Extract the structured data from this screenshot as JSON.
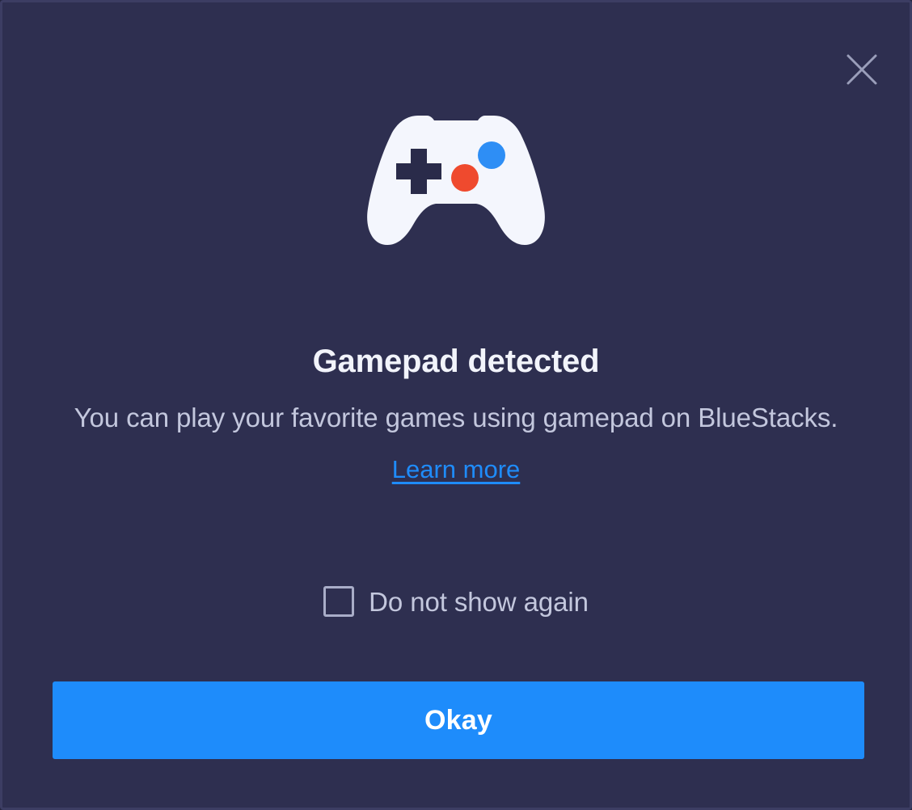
{
  "dialog": {
    "background_color": "#2e2f50",
    "border_color": "#3c3d63"
  },
  "close": {
    "icon_name": "close-icon",
    "label": "Close",
    "color": "#9a9eba"
  },
  "illustration": {
    "icon_name": "gamepad-icon",
    "body_color": "#f4f6fd",
    "dpad_color": "#2a2b4a",
    "button_blue": "#2e8ef5",
    "button_red": "#ef4a2e"
  },
  "content": {
    "title": "Gamepad detected",
    "description": "You can play your favorite games using gamepad on BlueStacks.",
    "learn_more_label": "Learn more",
    "link_color": "#1f8cfb",
    "title_color": "#f2f4fb",
    "text_color": "#c3c7dd"
  },
  "checkbox": {
    "label": "Do not show again",
    "checked": false,
    "border_color": "#a9adc8"
  },
  "primary_button": {
    "label": "Okay",
    "background_color": "#1e8cfb",
    "text_color": "#ffffff"
  }
}
